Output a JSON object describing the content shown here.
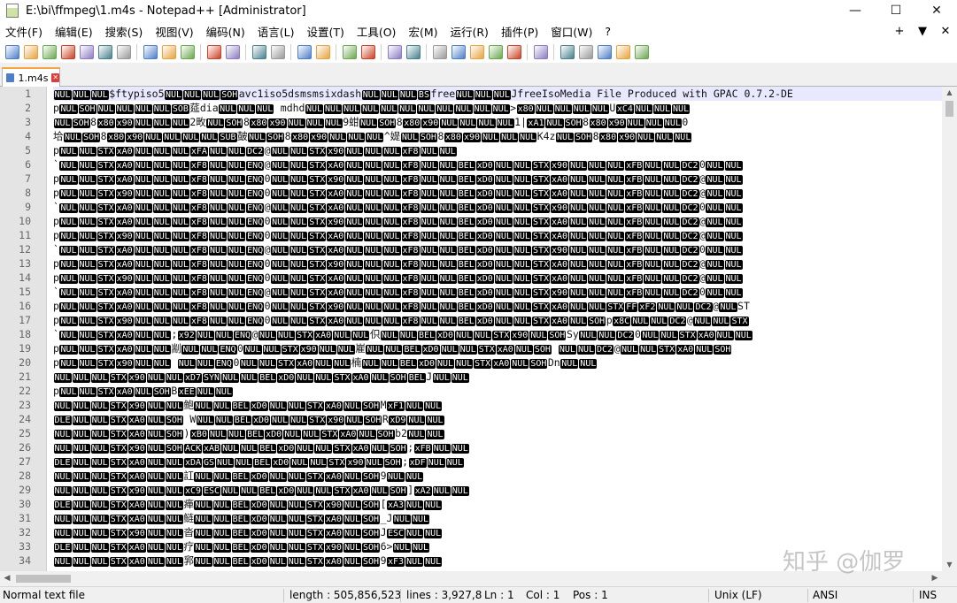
{
  "window": {
    "title": "E:\\bi\\ffmpeg\\1.m4s - Notepad++ [Administrator]",
    "buttons": [
      "—",
      "☐",
      "✕"
    ]
  },
  "menu": {
    "items": [
      "文件(F)",
      "编辑(E)",
      "搜索(S)",
      "视图(V)",
      "编码(N)",
      "语言(L)",
      "设置(T)",
      "工具(O)",
      "宏(M)",
      "运行(R)",
      "插件(P)",
      "窗口(W)",
      "?"
    ],
    "right": [
      "+",
      "▼",
      "✕"
    ]
  },
  "toolbar": {
    "icons": [
      "new-file-icon",
      "open-file-icon",
      "save-icon",
      "save-all-icon",
      "close-icon",
      "close-all-icon",
      "print-icon",
      "|",
      "cut-icon",
      "copy-icon",
      "paste-icon",
      "|",
      "undo-icon",
      "redo-icon",
      "|",
      "find-icon",
      "replace-icon",
      "|",
      "zoom-in-icon",
      "zoom-out-icon",
      "|",
      "sync-vertical-icon",
      "sync-horizontal-icon",
      "|",
      "word-wrap-icon",
      "show-all-chars-icon",
      "|",
      "indent-guide-icon",
      "user-lang-icon",
      "doc-map-icon",
      "function-list-icon",
      "folder-as-workspace-icon",
      "|",
      "monitor-icon",
      "|",
      "record-macro-icon",
      "stop-record-icon",
      "play-macro-icon",
      "run-macro-multiple-icon",
      "save-macro-icon"
    ]
  },
  "tab": {
    "label": "1.m4s"
  },
  "editor": {
    "current_line": 1,
    "lines": [
      [
        "NUL",
        "NUL",
        "NUL",
        "$ftypiso5",
        "NUL",
        "NUL",
        "NUL",
        "SOH",
        "avc1iso5dsmsmsixdash",
        "NUL",
        "NUL",
        "NUL",
        "BS",
        "free",
        "NUL",
        "NUL",
        "NUL",
        "JfreeIsoMedia File Produced with GPAC 0.7.2-DE"
      ],
      [
        "p",
        "NUL",
        "SOH",
        "NUL",
        "NUL",
        "NUL",
        "NUL",
        "SOB",
        "莚dia",
        "NUL",
        "NUL",
        "NUL",
        " mdhd",
        "NUL",
        "NUL",
        "NUL",
        "NUL",
        "NUL",
        "NUL",
        "NUL",
        "NUL",
        "NUL",
        "NUL",
        "NUL",
        ">",
        "x80",
        "NUL",
        "NUL",
        "NUL",
        "NUL",
        "U",
        "xC4",
        "NUL",
        "NUL",
        "NUL"
      ],
      [
        "NUL",
        "SOH",
        "8",
        "x80",
        "x90",
        "NUL",
        "NUL",
        "NUL",
        "2畋",
        "NUL",
        "SOH",
        "8",
        "x80",
        "x90",
        "NUL",
        "NUL",
        "NUL",
        "9蚶",
        "NUL",
        "SOH",
        "8",
        "x80",
        "x90",
        "NUL",
        "NUL",
        "NUL",
        "NUL",
        "1|",
        "xA1",
        "NUL",
        "SOH",
        "8",
        "x80",
        "x90",
        "NUL",
        "NUL",
        "NUL",
        "0"
      ],
      [
        "垥",
        "NUL",
        "SOH",
        "8",
        "x80",
        "x90",
        "NUL",
        "NUL",
        "NUL",
        "NUL",
        "SUB",
        "皷",
        "NUL",
        "SOH",
        "8",
        "x80",
        "x90",
        "NUL",
        "NUL",
        "NUL",
        "^媞",
        "NUL",
        "SOH",
        "8",
        "x80",
        "x90",
        "NUL",
        "NUL",
        "NUL",
        "K4z",
        "NUL",
        "SOH",
        "8",
        "x80",
        "x90",
        "NUL",
        "NUL",
        "NUL"
      ],
      [
        "p",
        "NUL",
        "NUL",
        "STX",
        "xA0",
        "NUL",
        "NUL",
        "NUL",
        "xFA",
        "NUL",
        "NUL",
        "DC2",
        "@",
        "NUL",
        "NUL",
        "STX",
        "x90",
        "NUL",
        "NUL",
        "NUL",
        "xF8",
        "NUL",
        "NUL"
      ],
      [
        "`",
        "NUL",
        "NUL",
        "STX",
        "xA0",
        "NUL",
        "NUL",
        "NUL",
        "xF8",
        "NUL",
        "NUL",
        "ENQ",
        "@",
        "NUL",
        "NUL",
        "STX",
        "xA0",
        "NUL",
        "NUL",
        "NUL",
        "xF8",
        "NUL",
        "NUL",
        "BEL",
        "xD0",
        "NUL",
        "NUL",
        "STX",
        "x90",
        "NUL",
        "NUL",
        "NUL",
        "xFB",
        "NUL",
        "NUL",
        "DC2",
        "0",
        "NUL",
        "NUL"
      ],
      [
        "p",
        "NUL",
        "NUL",
        "STX",
        "xA0",
        "NUL",
        "NUL",
        "NUL",
        "xF8",
        "NUL",
        "NUL",
        "ENQ",
        "0",
        "NUL",
        "NUL",
        "STX",
        "x90",
        "NUL",
        "NUL",
        "NUL",
        "xF8",
        "NUL",
        "NUL",
        "BEL",
        "xD0",
        "NUL",
        "NUL",
        "STX",
        "xA0",
        "NUL",
        "NUL",
        "NUL",
        "xFB",
        "NUL",
        "NUL",
        "DC2",
        "@",
        "NUL",
        "NUL"
      ],
      [
        "p",
        "NUL",
        "NUL",
        "STX",
        "x90",
        "NUL",
        "NUL",
        "NUL",
        "xF8",
        "NUL",
        "NUL",
        "ENQ",
        "0",
        "NUL",
        "NUL",
        "STX",
        "xA0",
        "NUL",
        "NUL",
        "NUL",
        "xF8",
        "NUL",
        "NUL",
        "BEL",
        "xD0",
        "NUL",
        "NUL",
        "STX",
        "xA0",
        "NUL",
        "NUL",
        "NUL",
        "xFB",
        "NUL",
        "NUL",
        "DC2",
        "@",
        "NUL",
        "NUL"
      ],
      [
        "`",
        "NUL",
        "NUL",
        "STX",
        "xA0",
        "NUL",
        "NUL",
        "NUL",
        "xF8",
        "NUL",
        "NUL",
        "ENQ",
        "@",
        "NUL",
        "NUL",
        "STX",
        "xA0",
        "NUL",
        "NUL",
        "NUL",
        "xF8",
        "NUL",
        "NUL",
        "BEL",
        "xD0",
        "NUL",
        "NUL",
        "STX",
        "x90",
        "NUL",
        "NUL",
        "NUL",
        "xFB",
        "NUL",
        "NUL",
        "DC2",
        "0",
        "NUL",
        "NUL"
      ],
      [
        "p",
        "NUL",
        "NUL",
        "STX",
        "xA0",
        "NUL",
        "NUL",
        "NUL",
        "xF8",
        "NUL",
        "NUL",
        "ENQ",
        "0",
        "NUL",
        "NUL",
        "STX",
        "x90",
        "NUL",
        "NUL",
        "NUL",
        "xF8",
        "NUL",
        "NUL",
        "BEL",
        "xD0",
        "NUL",
        "NUL",
        "STX",
        "xA0",
        "NUL",
        "NUL",
        "NUL",
        "xFB",
        "NUL",
        "NUL",
        "DC2",
        "@",
        "NUL",
        "NUL"
      ],
      [
        "p",
        "NUL",
        "NUL",
        "STX",
        "x90",
        "NUL",
        "NUL",
        "NUL",
        "xF8",
        "NUL",
        "NUL",
        "ENQ",
        "0",
        "NUL",
        "NUL",
        "STX",
        "xA0",
        "NUL",
        "NUL",
        "NUL",
        "xF8",
        "NUL",
        "NUL",
        "BEL",
        "xD0",
        "NUL",
        "NUL",
        "STX",
        "xA0",
        "NUL",
        "NUL",
        "NUL",
        "xFB",
        "NUL",
        "NUL",
        "DC2",
        "@",
        "NUL",
        "NUL"
      ],
      [
        "`",
        "NUL",
        "NUL",
        "STX",
        "xA0",
        "NUL",
        "NUL",
        "NUL",
        "xF8",
        "NUL",
        "NUL",
        "ENQ",
        "@",
        "NUL",
        "NUL",
        "STX",
        "xA0",
        "NUL",
        "NUL",
        "NUL",
        "xF8",
        "NUL",
        "NUL",
        "BEL",
        "xD0",
        "NUL",
        "NUL",
        "STX",
        "x90",
        "NUL",
        "NUL",
        "NUL",
        "xFB",
        "NUL",
        "NUL",
        "DC2",
        "0",
        "NUL",
        "NUL"
      ],
      [
        "p",
        "NUL",
        "NUL",
        "STX",
        "xA0",
        "NUL",
        "NUL",
        "NUL",
        "xF8",
        "NUL",
        "NUL",
        "ENQ",
        "0",
        "NUL",
        "NUL",
        "STX",
        "x90",
        "NUL",
        "NUL",
        "NUL",
        "xF8",
        "NUL",
        "NUL",
        "BEL",
        "xD0",
        "NUL",
        "NUL",
        "STX",
        "xA0",
        "NUL",
        "NUL",
        "NUL",
        "xFB",
        "NUL",
        "NUL",
        "DC2",
        "@",
        "NUL",
        "NUL"
      ],
      [
        "p",
        "NUL",
        "NUL",
        "STX",
        "x90",
        "NUL",
        "NUL",
        "NUL",
        "xF8",
        "NUL",
        "NUL",
        "ENQ",
        "0",
        "NUL",
        "NUL",
        "STX",
        "xA0",
        "NUL",
        "NUL",
        "NUL",
        "xF8",
        "NUL",
        "NUL",
        "BEL",
        "xD0",
        "NUL",
        "NUL",
        "STX",
        "xA0",
        "NUL",
        "NUL",
        "NUL",
        "xFB",
        "NUL",
        "NUL",
        "DC2",
        "@",
        "NUL",
        "NUL"
      ],
      [
        "`",
        "NUL",
        "NUL",
        "STX",
        "xA0",
        "NUL",
        "NUL",
        "NUL",
        "xF8",
        "NUL",
        "NUL",
        "ENQ",
        "@",
        "NUL",
        "NUL",
        "STX",
        "xA0",
        "NUL",
        "NUL",
        "NUL",
        "xF8",
        "NUL",
        "NUL",
        "BEL",
        "xD0",
        "NUL",
        "NUL",
        "STX",
        "x90",
        "NUL",
        "NUL",
        "NUL",
        "xFB",
        "NUL",
        "NUL",
        "DC2",
        "0",
        "NUL",
        "NUL"
      ],
      [
        "p",
        "NUL",
        "NUL",
        "STX",
        "xA0",
        "NUL",
        "NUL",
        "NUL",
        "xF8",
        "NUL",
        "NUL",
        "ENQ",
        "0",
        "NUL",
        "NUL",
        "STX",
        "x90",
        "NUL",
        "NUL",
        "NUL",
        "xF8",
        "NUL",
        "NUL",
        "BEL",
        "xD0",
        "NUL",
        "NUL",
        "STX",
        "xA0",
        "NUL",
        "NUL",
        "STX",
        "FF",
        "xF2",
        "NUL",
        "NUL",
        "DC2",
        "@",
        "NUL",
        "ST"
      ],
      [
        "p",
        "NUL",
        "NUL",
        "STX",
        "x90",
        "NUL",
        "NUL",
        "NUL",
        "xF8",
        "NUL",
        "NUL",
        "ENQ",
        "0",
        "NUL",
        "NUL",
        "STX",
        "xA0",
        "NUL",
        "NUL",
        "NUL",
        "xF8",
        "NUL",
        "NUL",
        "BEL",
        "xD0",
        "NUL",
        "NUL",
        "STX",
        "xA0",
        "NUL",
        "SOH",
        "p",
        "x8C",
        "NUL",
        "NUL",
        "DC2",
        "@",
        "NUL",
        "NUL",
        "STX"
      ],
      [
        "`",
        "NUL",
        "NUL",
        "STX",
        "xA0",
        "NUL",
        "NUL",
        ";",
        "x92",
        "NUL",
        "NUL",
        "ENQ",
        "@",
        "NUL",
        "NUL",
        "STX",
        "xA0",
        "NUL",
        "NUL",
        "伿",
        "NUL",
        "NUL",
        "BEL",
        "xD0",
        "NUL",
        "NUL",
        "STX",
        "x90",
        "NUL",
        "SOH",
        "Sy",
        "NUL",
        "NUL",
        "DC2",
        "0",
        "NUL",
        "NUL",
        "STX",
        "xA0",
        "NUL",
        "NUL"
      ],
      [
        "p",
        "NUL",
        "NUL",
        "STX",
        "xA0",
        "NUL",
        "NUL",
        "剬",
        "NUL",
        "NUL",
        "ENQ",
        "0",
        "NUL",
        "NUL",
        "STX",
        "x90",
        "NUL",
        "NUL",
        "嵟",
        "NUL",
        "NUL",
        "BEL",
        "xD0",
        "NUL",
        "NUL",
        "STX",
        "xA0",
        "NUL",
        "SOH",
        "  ",
        "NUL",
        "NUL",
        "DC2",
        "@",
        "NUL",
        "NUL",
        "STX",
        "xA0",
        "NUL",
        "SOH"
      ],
      [
        "p",
        "NUL",
        "NUL",
        "STX",
        "x90",
        "NUL",
        "NUL",
        "  ",
        "NUL",
        "NUL",
        "ENQ",
        "0",
        "NUL",
        "NUL",
        "STX",
        "xA0",
        "NUL",
        "NUL",
        "楠",
        "NUL",
        "NUL",
        "BEL",
        "xD0",
        "NUL",
        "NUL",
        "STX",
        "xA0",
        "NUL",
        "SOH",
        "Dn",
        "NUL",
        "NUL"
      ],
      [
        "NUL",
        "NUL",
        "NUL",
        "STX",
        "x90",
        "NUL",
        "NUL",
        "xD7",
        "SYN",
        "NUL",
        "NUL",
        "BEL",
        "xD0",
        "NUL",
        "NUL",
        "STX",
        "xA0",
        "NUL",
        "SOH",
        "BEL",
        "J",
        "NUL",
        "NUL"
      ],
      [
        "p",
        "NUL",
        "NUL",
        "STX",
        "xA0",
        "NUL",
        "SOH",
        "B",
        "xEE",
        "NUL",
        "NUL"
      ],
      [
        "NUL",
        "NUL",
        "NUL",
        "STX",
        "x90",
        "NUL",
        "NUL",
        "鲍",
        "NUL",
        "NUL",
        "BEL",
        "xD0",
        "NUL",
        "NUL",
        "STX",
        "xA0",
        "NUL",
        "SOH",
        "M",
        "xF1",
        "NUL",
        "NUL"
      ],
      [
        "DLE",
        "NUL",
        "NUL",
        "STX",
        "xA0",
        "NUL",
        "SOH",
        " W",
        "NUL",
        "NUL",
        "BEL",
        "xD0",
        "NUL",
        "NUL",
        "STX",
        "x90",
        "NUL",
        "SOH",
        "R",
        "xD9",
        "NUL",
        "NUL"
      ],
      [
        "NUL",
        "NUL",
        "NUL",
        "STX",
        "xA0",
        "NUL",
        "SOH",
        ")",
        "xB0",
        "NUL",
        "NUL",
        "BEL",
        "xD0",
        "NUL",
        "NUL",
        "STX",
        "xA0",
        "NUL",
        "SOH",
        "b2",
        "NUL",
        "NUL"
      ],
      [
        "NUL",
        "NUL",
        "NUL",
        "STX",
        "x90",
        "NUL",
        "SOH",
        "ACK",
        "xAB",
        "NUL",
        "NUL",
        "BEL",
        "xD0",
        "NUL",
        "NUL",
        "STX",
        "xA0",
        "NUL",
        "SOH",
        ";",
        "xFB",
        "NUL",
        "NUL"
      ],
      [
        "DLE",
        "NUL",
        "NUL",
        "STX",
        "xA0",
        "NUL",
        "NUL",
        "xDA",
        "GS",
        "NUL",
        "NUL",
        "BEL",
        "xD0",
        "NUL",
        "NUL",
        "STX",
        "x90",
        "NUL",
        "SOH",
        ";",
        "xDF",
        "NUL",
        "NUL"
      ],
      [
        "NUL",
        "NUL",
        "NUL",
        "STX",
        "xA0",
        "NUL",
        "NUL",
        "訌",
        "NUL",
        "NUL",
        "BEL",
        "xD0",
        "NUL",
        "NUL",
        "STX",
        "xA0",
        "NUL",
        "SOH",
        "9",
        "NUL",
        "NUL"
      ],
      [
        "NUL",
        "NUL",
        "NUL",
        "STX",
        "x90",
        "NUL",
        "NUL",
        "xC9",
        "ESC",
        "NUL",
        "NUL",
        "BEL",
        "xD0",
        "NUL",
        "NUL",
        "STX",
        "xA0",
        "NUL",
        "SOH",
        "]",
        "xA2",
        "NUL",
        "NUL"
      ],
      [
        "DLE",
        "NUL",
        "NUL",
        "STX",
        "xA0",
        "NUL",
        "NUL",
        "瘅",
        "NUL",
        "NUL",
        "BEL",
        "xD0",
        "NUL",
        "NUL",
        "STX",
        "x90",
        "NUL",
        "SOH",
        "[",
        "xA3",
        "NUL",
        "NUL"
      ],
      [
        "NUL",
        "NUL",
        "NUL",
        "STX",
        "xA0",
        "NUL",
        "NUL",
        "鲢",
        "NUL",
        "NUL",
        "BEL",
        "xD0",
        "NUL",
        "NUL",
        "STX",
        "xA0",
        "NUL",
        "SOH",
        "_J",
        "NUL",
        "NUL"
      ],
      [
        "NUL",
        "NUL",
        "NUL",
        "STX",
        "x90",
        "NUL",
        "NUL",
        "沓",
        "NUL",
        "NUL",
        "BEL",
        "xD0",
        "NUL",
        "NUL",
        "STX",
        "xA0",
        "NUL",
        "SOH",
        "J",
        "ESC",
        "NUL",
        "NUL"
      ],
      [
        "DLE",
        "NUL",
        "NUL",
        "STX",
        "xA0",
        "NUL",
        "NUL",
        "疗",
        "NUL",
        "NUL",
        "BEL",
        "xD0",
        "NUL",
        "NUL",
        "STX",
        "x90",
        "NUL",
        "SOH",
        "6>",
        "NUL",
        "NUL"
      ],
      [
        "NUL",
        "NUL",
        "NUL",
        "STX",
        "xA0",
        "NUL",
        "NUL",
        "郛",
        "NUL",
        "NUL",
        "BEL",
        "xD0",
        "NUL",
        "NUL",
        "STX",
        "xA0",
        "NUL",
        "SOH",
        "9",
        "xF3",
        "NUL",
        "NUL"
      ]
    ]
  },
  "status": {
    "file_type": "Normal text file",
    "length": "length : 505,856,523",
    "lines": "lines : 3,927,86",
    "ln": "Ln : 1",
    "col": "Col : 1",
    "pos": "Pos : 1",
    "eol": "Unix (LF)",
    "encoding": "ANSI",
    "mode": "INS"
  },
  "watermark": "知乎 @伽罗"
}
